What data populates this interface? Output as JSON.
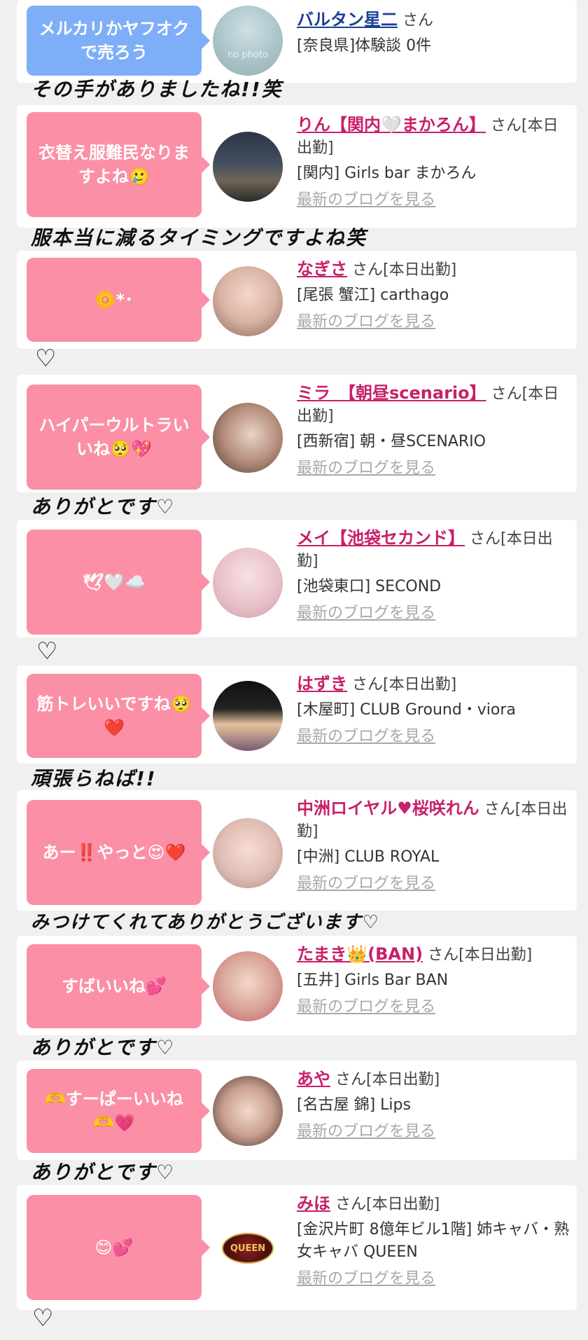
{
  "entries": [
    {
      "bubble": "メルカリかヤフオクで売ろう",
      "name": "バルタン星二",
      "suffix": "さん",
      "shop": "[奈良県]体験談 0件",
      "blog": "",
      "avatar_text": "no photo",
      "note": "その手がありましたね!!笑"
    },
    {
      "bubble": "衣替え服難民なりますよね🥲",
      "name": "りん【関内🤍まかろん】",
      "suffix": "さん[本日出勤]",
      "shop": "[関内] Girls bar まかろん",
      "blog": "最新のブログを見る",
      "note": "服本当に減るタイミングですよね笑"
    },
    {
      "bubble": "🌼*･",
      "name": "なぎさ",
      "suffix": "さん[本日出勤]",
      "shop": "[尾張 蟹江] carthago",
      "blog": "最新のブログを見る",
      "note": "♡"
    },
    {
      "bubble": "ハイパーウルトラいいね🥺💖",
      "name": "ミラ　【朝昼scenario】",
      "suffix": "さん[本日出勤]",
      "shop": "[西新宿] 朝・昼SCENARIO",
      "blog": "最新のブログを見る",
      "note": "ありがとです♡"
    },
    {
      "bubble": "🕊🤍☁️",
      "name": "メイ【池袋セカンド】",
      "suffix": "さん[本日出勤]",
      "shop": "[池袋東口] SECOND",
      "blog": "最新のブログを見る",
      "note": "♡"
    },
    {
      "bubble": "筋トレいいですね🥺❤️",
      "name": "はずき",
      "suffix": "さん[本日出勤]",
      "shop": "[木屋町] CLUB Ground・viora",
      "blog": "最新のブログを見る",
      "note": "頑張らねば!!"
    },
    {
      "bubble": "あー‼️やっと😍❤️",
      "name": "中洲ロイヤル♥桜咲れん",
      "suffix": "さん[本日出勤]",
      "shop": "[中洲] CLUB ROYAL",
      "blog": "最新のブログを見る",
      "note": "みつけてくれてありがとうございます♡"
    },
    {
      "bubble": "すばいいね💕",
      "name": "たまき👑(BAN)",
      "suffix": "さん[本日出勤]",
      "shop": "[五井] Girls Bar BAN",
      "blog": "最新のブログを見る",
      "note": "ありがとです♡"
    },
    {
      "bubble": "🫶すーぱーいいね🫶💗",
      "name": "あや",
      "suffix": "さん[本日出勤]",
      "shop": "[名古屋 錦] Lips",
      "blog": "最新のブログを見る",
      "note": "ありがとです♡"
    },
    {
      "bubble": "😊💕",
      "name": "みほ",
      "suffix": "さん[本日出勤]",
      "shop": "[金沢片町 8億年ビル1階] 姉キャバ・熟女キャバ QUEEN",
      "blog": "最新のブログを見る",
      "avatar_text": "QUEEN",
      "note": "♡"
    }
  ]
}
